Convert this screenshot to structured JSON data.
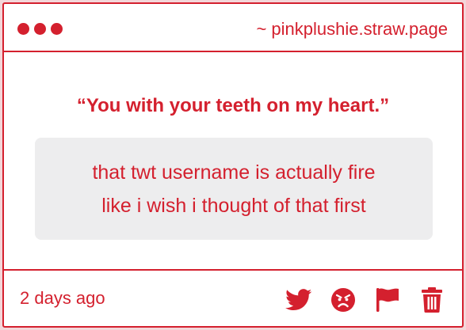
{
  "header": {
    "site": "~ pinkplushie.straw.page"
  },
  "main": {
    "quote": "“You with your teeth on my heart.”",
    "message_lines": [
      "that twt username is actually fire",
      "like i wish i thought of that first"
    ]
  },
  "footer": {
    "timestamp": "2 days ago",
    "actions": [
      "twitter-icon",
      "angry-face-icon",
      "flag-icon",
      "trash-icon"
    ]
  },
  "colors": {
    "accent": "#d4202e",
    "message_bg": "#ededee",
    "page_bg": "#f3d6d9"
  }
}
